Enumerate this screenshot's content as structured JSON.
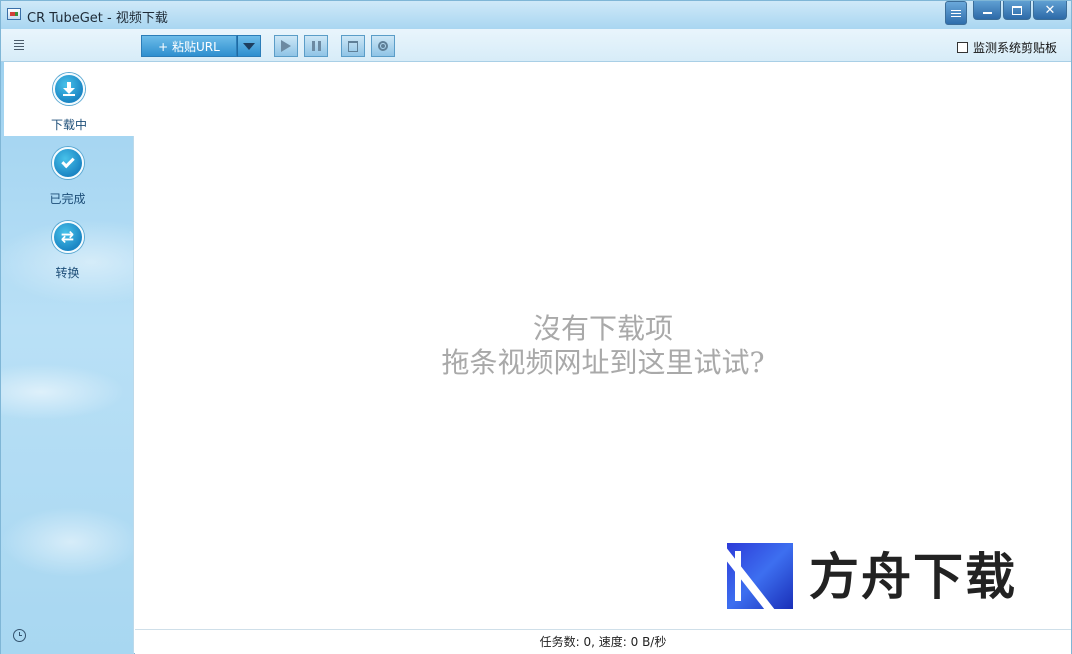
{
  "window": {
    "title": "CR TubeGet - 视频下载"
  },
  "toolbar": {
    "paste_label": "+ 粘贴URL",
    "monitor_label": "监测系统剪贴板",
    "monitor_checked": false
  },
  "sidebar": {
    "items": [
      {
        "label": "下载中",
        "icon": "download-icon",
        "active": true
      },
      {
        "label": "已完成",
        "icon": "check-icon",
        "active": false
      },
      {
        "label": "转换",
        "icon": "convert-icon",
        "active": false
      }
    ]
  },
  "main": {
    "empty_line1": "沒有下载项",
    "empty_line2": "拖条视频网址到这里试试?"
  },
  "watermark": {
    "text": "方舟下载"
  },
  "status": {
    "text": "任务数: 0, 速度: 0 B/秒"
  },
  "colors": {
    "accent": "#2e8fcf",
    "sidebar_bg": "#a8d7f1",
    "empty_text": "#a9a9a9"
  }
}
